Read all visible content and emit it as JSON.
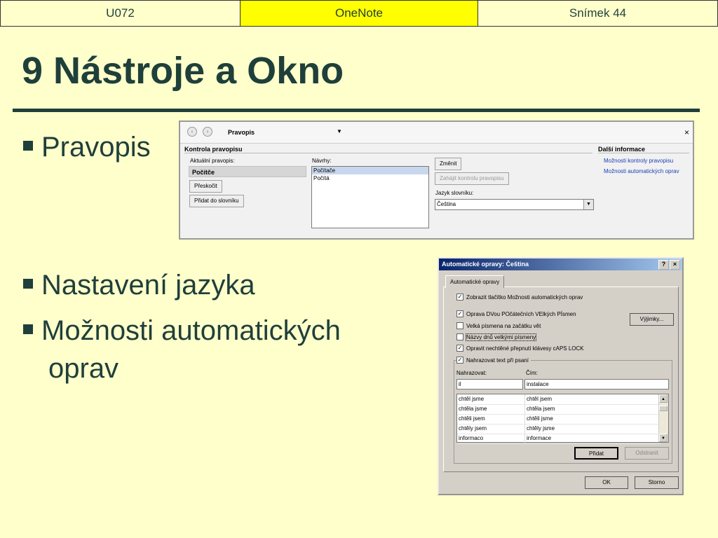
{
  "header": {
    "left": "U072",
    "center": "OneNote",
    "right": "Snímek 44"
  },
  "slide": {
    "title": "9 Nástroje a Okno",
    "bullets": [
      "Pravopis",
      "Nastavení jazyka",
      "Možnosti automatických"
    ],
    "bullet3_cont": "oprav"
  },
  "spelling_pane": {
    "title": "Pravopis",
    "close": "×",
    "section": "Kontrola pravopisu",
    "info_section": "Další informace",
    "current_label": "Aktuální pravopis:",
    "current_value": "Počítče",
    "skip_button": "Přeskočit",
    "add_button": "Přidat do slovníku",
    "suggestions_label": "Návrhy:",
    "suggestions": [
      "Počítače",
      "Počítá"
    ],
    "change_button": "Změnit",
    "start_button": "Zahájit kontrolu pravopisu",
    "dictionary_label": "Jazyk slovníku:",
    "dictionary_value": "Čeština",
    "links": [
      "Možnosti kontroly pravopisu",
      "Možnosti automatických oprav"
    ]
  },
  "autocorrect_dialog": {
    "title": "Automatické opravy: Čeština",
    "help": "?",
    "close": "×",
    "tab": "Automatické opravy",
    "options": [
      {
        "label": "Zobrazit tlačítko Možnosti automatických oprav",
        "checked": true
      },
      {
        "label": "Oprava DVou POčátečních VElkých PÍsmen",
        "checked": true
      },
      {
        "label": "Velká písmena na začátku vět",
        "checked": false
      },
      {
        "label": "Názvy dnů velkými písmeny",
        "checked": false
      },
      {
        "label": "Opravit nechtěné přepnutí klávesy cAPS LOCK",
        "checked": true
      },
      {
        "label": "Nahrazovat text při psaní",
        "checked": true
      }
    ],
    "exceptions_button": "Výjimky...",
    "replace_label": "Nahrazovat:",
    "with_label": "Čím:",
    "replace_value": "il",
    "with_value": "instalace",
    "entries": [
      [
        "chtěl jsme",
        "chtěl jsem"
      ],
      [
        "chtěla jsme",
        "chtěla jsem"
      ],
      [
        "chtěli jsem",
        "chtěli jsme"
      ],
      [
        "chtěly jsem",
        "chtěly jsme"
      ],
      [
        "informaco",
        "informace"
      ]
    ],
    "add_button": "Přidat",
    "remove_button": "Odstranit",
    "ok_button": "OK",
    "cancel_button": "Storno"
  }
}
